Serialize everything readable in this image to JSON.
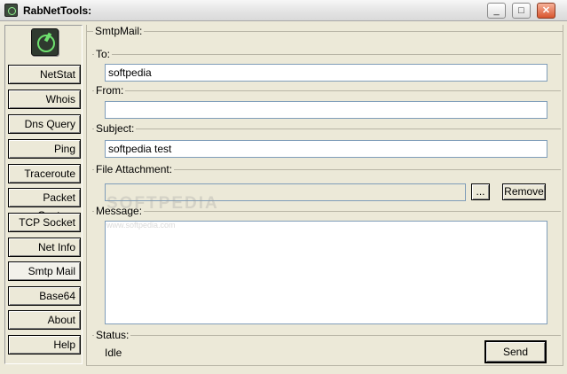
{
  "window": {
    "title": "RabNetTools:",
    "controls": {
      "minimize": "_",
      "maximize": "□",
      "close": "✕"
    }
  },
  "sidebar": {
    "logo_icon": "rabnettools-logo-icon",
    "items": [
      {
        "label": "NetStat",
        "active": false
      },
      {
        "label": "Whois",
        "active": false
      },
      {
        "label": "Dns Query",
        "active": false
      },
      {
        "label": "Ping",
        "active": false
      },
      {
        "label": "Traceroute",
        "active": false
      },
      {
        "label": "Packet Capture",
        "active": false
      },
      {
        "label": "TCP Socket",
        "active": false
      },
      {
        "label": "Net Info",
        "active": false
      },
      {
        "label": "Smtp Mail",
        "active": true
      },
      {
        "label": "Base64",
        "active": false
      },
      {
        "label": "About",
        "active": false
      },
      {
        "label": "Help",
        "active": false
      }
    ]
  },
  "smtp": {
    "group_title": "SmtpMail:",
    "to_label": "To:",
    "to_value": "softpedia",
    "from_label": "From:",
    "from_value": "",
    "subject_label": "Subject:",
    "subject_value": "softpedia test",
    "attachment_label": "File Attachment:",
    "attachment_value": "",
    "browse_label": "...",
    "remove_label": "Remove",
    "message_label": "Message:",
    "message_value": "",
    "status_label": "Status:",
    "status_value": "Idle",
    "send_label": "Send"
  },
  "watermark": {
    "text": "SOFTPEDIA",
    "sub": "www.softpedia.com"
  }
}
